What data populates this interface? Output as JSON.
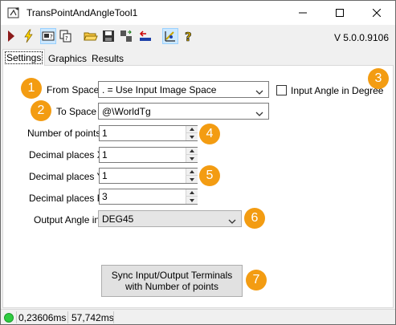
{
  "window": {
    "title": "TransPointAndAngleTool1",
    "version": "V 5.0.0.9106"
  },
  "toolbar": {
    "icons": [
      "run-icon",
      "lightning-icon",
      "image-settings-icon",
      "copy-icon",
      "open-folder-icon",
      "save-icon",
      "transfer-icon",
      "import-icon",
      "calibration-icon",
      "help-icon"
    ]
  },
  "tabs": [
    {
      "label": "Settings",
      "selected": true
    },
    {
      "label": "Graphics",
      "selected": false
    },
    {
      "label": "Results",
      "selected": false
    }
  ],
  "settings": {
    "from_space": {
      "label": "From Space",
      "value": ". = Use Input Image Space"
    },
    "input_angle": {
      "label": "Input Angle in Degree",
      "checked": false
    },
    "to_space": {
      "label": "To Space",
      "value": "@\\WorldTg"
    },
    "num_points": {
      "label": "Number of points",
      "value": "1"
    },
    "decimal_x": {
      "label": "Decimal places X",
      "value": "1"
    },
    "decimal_y": {
      "label": "Decimal places Y",
      "value": "1"
    },
    "decimal_r": {
      "label": "Decimal places R",
      "value": "3"
    },
    "output_angle": {
      "label": "Output Angle in",
      "value": "DEG45"
    },
    "sync_button": {
      "line1": "Sync Input/Output Terminals",
      "line2": "with Number of points"
    }
  },
  "badges": [
    "1",
    "2",
    "3",
    "4",
    "5",
    "6",
    "7"
  ],
  "status": {
    "indicator_color": "#2ecc40",
    "time1": "0,23606ms",
    "time2": "57,742ms"
  },
  "colors": {
    "badge": "#f39c12",
    "accent": "#cce8ff"
  }
}
